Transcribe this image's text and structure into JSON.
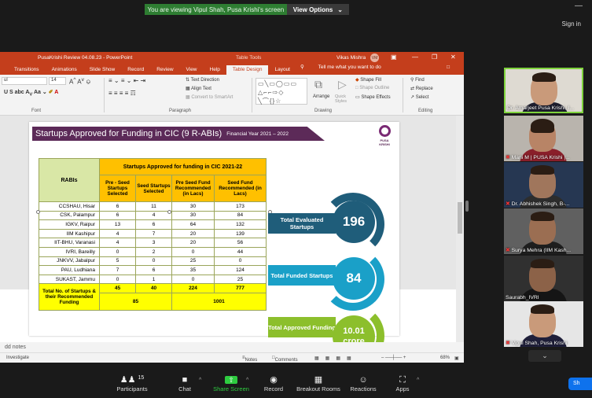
{
  "zoom": {
    "banner": "You are viewing Vipul Shah, Pusa Krishi's screen",
    "view_options": "View Options",
    "view_options_icon": "chevron-down",
    "minimize": "—",
    "sign_in": "Sign in"
  },
  "ppt": {
    "doc_title": "PusaKrishi Review 04.08.23 - PowerPoint",
    "table_tools": "Table Tools",
    "user": "Vikas Mishra",
    "user_initials": "VM",
    "tabs": [
      "Transitions",
      "Animations",
      "Slide Show",
      "Record",
      "Review",
      "View",
      "Help",
      "Table Design",
      "Layout"
    ],
    "tell_me": "Tell me what you want to do",
    "ribbon": {
      "font_name": "ul",
      "font_size": "14",
      "font_group": "Font",
      "paragraph_group": "Paragraph",
      "drawing_group": "Drawing",
      "editing_group": "Editing",
      "text_direction": "Text Direction",
      "align_text": "Align Text",
      "convert_smartart": "Convert to SmartArt",
      "arrange": "Arrange",
      "quick_styles": "Quick Styles",
      "shape_fill": "Shape Fill",
      "shape_outline": "Shape Outline",
      "shape_effects": "Shape Effects",
      "find": "Find",
      "replace": "Replace",
      "select": "Select"
    },
    "add_notes": "dd notes",
    "status_left": "Investigate",
    "notes_btn": "Notes",
    "comments_btn": "Comments",
    "zoom_level": "68%"
  },
  "slide": {
    "title": "Startups Approved for Funding in CIC (9 R-ABIs)",
    "year": "Financial Year 2021 – 2022",
    "logo_text": "PUSA KRISHI",
    "table": {
      "head_rabi": "RABIs",
      "head_main": "Startups Approved for funding in CIC 2021-22",
      "sub_heads": [
        "Pre - Seed Startups Selected",
        "Seed Startups Selected",
        "Pre Seed Fund Recommended (in Lacs)",
        "Seed Fund Recommended (in Lacs)"
      ],
      "rows": [
        [
          "CCSHAU, Hisar",
          "6",
          "11",
          "30",
          "173"
        ],
        [
          "CSK, Palampur",
          "6",
          "4",
          "30",
          "84"
        ],
        [
          "IGKV, Raipur",
          "13",
          "6",
          "64",
          "132"
        ],
        [
          "IIM Kashipur",
          "4",
          "7",
          "20",
          "139"
        ],
        [
          "IIT-BHU, Varanasi",
          "4",
          "3",
          "20",
          "56"
        ],
        [
          "IVRI, Bareilly",
          "0",
          "2",
          "0",
          "44"
        ],
        [
          "JNKVV, Jabalpur",
          "5",
          "0",
          "25",
          "0"
        ],
        [
          "PAU, Ludhiana",
          "7",
          "6",
          "35",
          "124"
        ],
        [
          "SUKAST, Jammu",
          "0",
          "1",
          "0",
          "25"
        ]
      ],
      "total_label": "Total No. of Startups & their Recommended Funding",
      "totals": [
        "45",
        "40",
        "224",
        "777"
      ],
      "combined": [
        "85",
        "1001"
      ]
    },
    "stats": [
      {
        "label": "Total Evaluated Startups",
        "value": "196",
        "color": "#1f5d7a"
      },
      {
        "label": "Total Funded Startups",
        "value": "84",
        "color": "#1aa0c8"
      },
      {
        "label": "Total Approved Funding",
        "value": "10.01 crore",
        "value_line1": "10.01",
        "value_line2": "crore",
        "color": "#8cbf2c"
      }
    ]
  },
  "participants": [
    {
      "name": "Dr. Amarjeet Pusa Krishi, I..."
    },
    {
      "name": "Mani M | PUSA Krishi |..."
    },
    {
      "name": "Dr. Abhishek Singh, B-..."
    },
    {
      "name": "Surya Mehra (IIM Kash..."
    },
    {
      "name": "Saurabh_IVRI"
    },
    {
      "name": "Vipul Shah, Pusa Krishi"
    }
  ],
  "toolbar": {
    "participants": "Participants",
    "participants_count": "15",
    "chat": "Chat",
    "share": "Share Screen",
    "record": "Record",
    "breakout": "Breakout Rooms",
    "reactions": "Reactions",
    "apps": "Apps",
    "corner": "Sh"
  }
}
